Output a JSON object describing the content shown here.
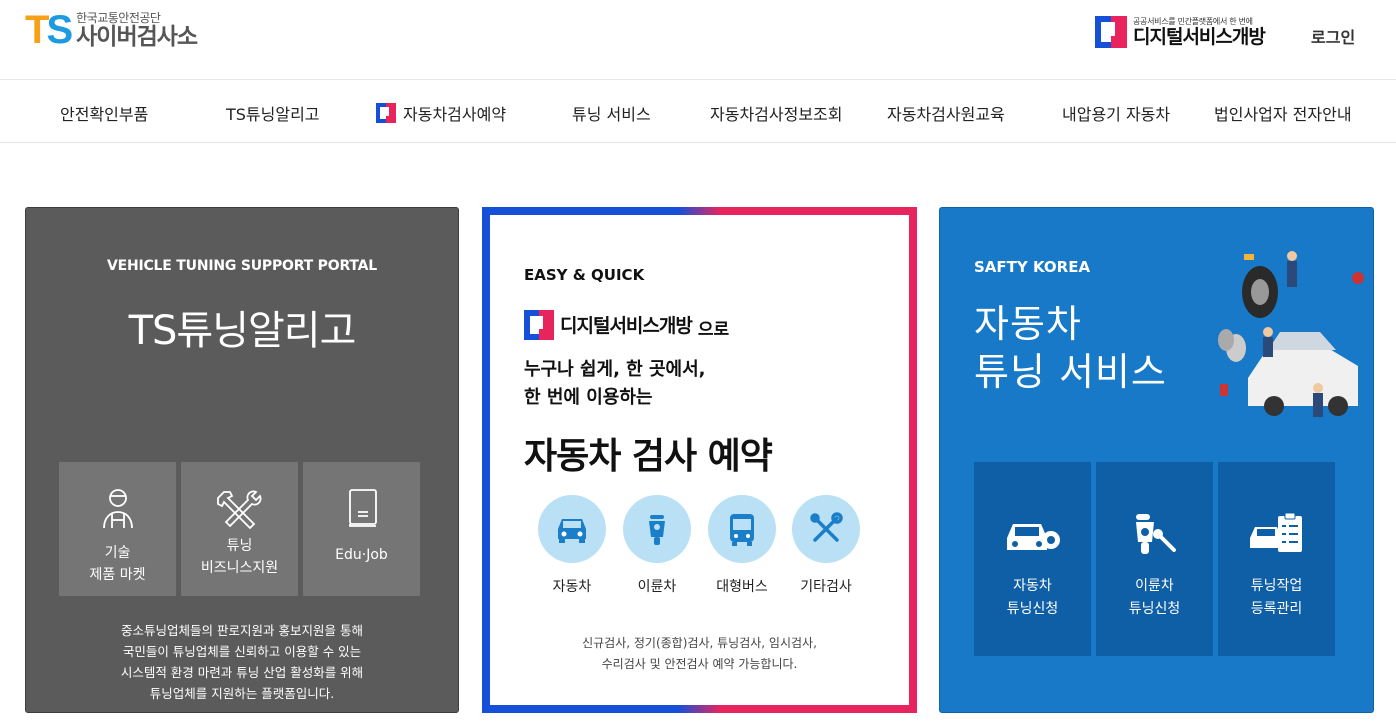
{
  "header": {
    "logo_text": "TS",
    "logo_sub": "한국교통안전공단",
    "logo_main": "사이버검사소",
    "dsv_sub": "공공서비스를 민간플랫폼에서 한 번에",
    "dsv_main": "디지털서비스개방",
    "login": "로그인"
  },
  "nav": [
    {
      "label": "안전확인부품"
    },
    {
      "label": "TS튜닝알리고"
    },
    {
      "label": "자동차검사예약"
    },
    {
      "label": "튜닝 서비스"
    },
    {
      "label": "자동차검사정보조회"
    },
    {
      "label": "자동차검사원교육"
    },
    {
      "label": "내압용기 자동차"
    },
    {
      "label": "법인사업자 전자안내"
    }
  ],
  "card1": {
    "eyebrow": "VEHICLE TUNING SUPPORT PORTAL",
    "title": "TS튜닝알리고",
    "tiles": [
      {
        "line1": "기술",
        "line2": "제품 마켓",
        "icon": "mechanic-icon"
      },
      {
        "line1": "튜닝",
        "line2": "비즈니스지원",
        "icon": "tools-icon"
      },
      {
        "line1": "Edu·Job",
        "line2": "",
        "icon": "document-icon"
      }
    ],
    "desc": [
      "중소튜닝업체들의 판로지원과 홍보지원을 통해",
      "국민들이 튜닝업체를 신뢰하고 이용할 수 있는",
      "시스템적 환경 마련과 튜닝 산업 활성화를 위해",
      "튜닝업체를 지원하는 플랫폼입니다."
    ]
  },
  "card2": {
    "eyebrow": "EASY & QUICK",
    "brand": "디지털서비스개방",
    "brand_suffix": "으로",
    "line1": "누구나 쉽게, 한 곳에서,",
    "line2": "한 번에 이용하는",
    "hero": "자동차 검사 예약",
    "items": [
      {
        "label": "자동차",
        "icon": "car-icon"
      },
      {
        "label": "이륜차",
        "icon": "motorcycle-icon"
      },
      {
        "label": "대형버스",
        "icon": "bus-icon"
      },
      {
        "label": "기타검사",
        "icon": "tools-icon"
      }
    ],
    "note1": "신규검사, 정기(종합)검사, 튜닝검사, 임시검사,",
    "note2": "수리검사 및 안전검사 예약 가능합니다."
  },
  "card3": {
    "eyebrow": "SAFTY KOREA",
    "title1": "자동차",
    "title2": "튜닝 서비스",
    "tiles": [
      {
        "line1": "자동차",
        "line2": "튜닝신청",
        "icon": "car-gear-icon"
      },
      {
        "line1": "이륜차",
        "line2": "튜닝신청",
        "icon": "scooter-tool-icon"
      },
      {
        "line1": "튜닝작업",
        "line2": "등록관리",
        "icon": "checklist-car-icon"
      }
    ]
  },
  "colors": {
    "card1_bg": "#5b5b5b",
    "card3_bg": "#1779c8",
    "accent_blue": "#1650d8",
    "accent_red": "#e8245e",
    "circle_bg": "#b9e0f5"
  }
}
